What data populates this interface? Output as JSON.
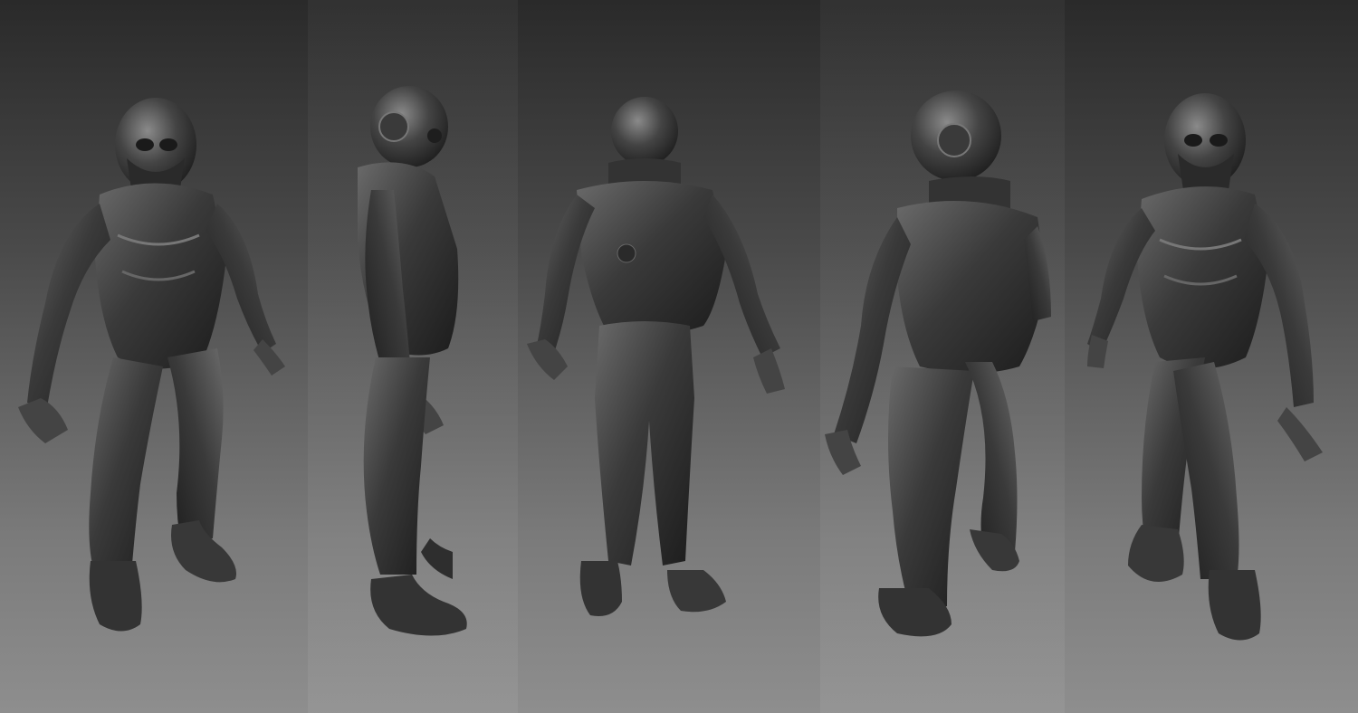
{
  "scene": {
    "background": {
      "top_color": "#2a2a2a",
      "bottom_color": "#8e8e8e"
    },
    "material_color": "#3c3c3c",
    "views": [
      {
        "name": "front-three-quarter"
      },
      {
        "name": "side"
      },
      {
        "name": "back"
      },
      {
        "name": "rear-three-quarter"
      },
      {
        "name": "front-three-quarter-mirrored"
      }
    ]
  }
}
